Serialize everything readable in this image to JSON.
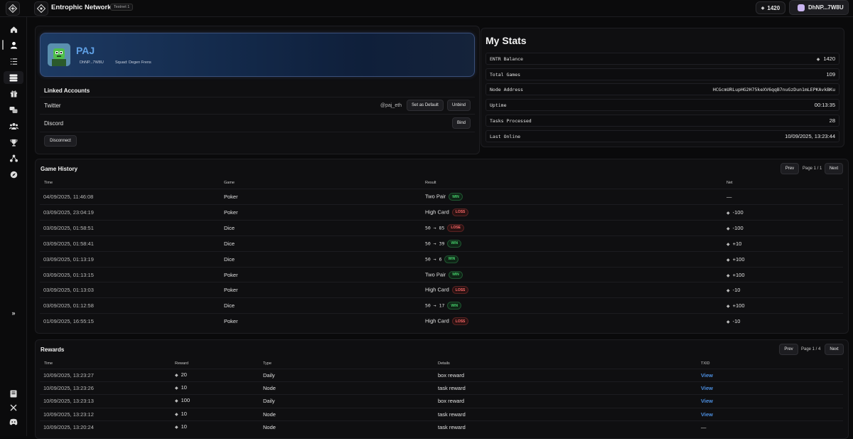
{
  "app": {
    "title": "Entrophic Network",
    "network_badge": "Testnet 1"
  },
  "topbar": {
    "balance": "1420",
    "wallet": "DhNP...7W8U"
  },
  "sidebar": {
    "items": [
      {
        "name": "home-icon"
      },
      {
        "name": "profile-icon"
      },
      {
        "name": "tasks-list-icon"
      },
      {
        "name": "nodes-icon"
      },
      {
        "name": "gift-icon"
      },
      {
        "name": "games-icon"
      },
      {
        "name": "squads-icon"
      },
      {
        "name": "trophy-icon"
      },
      {
        "name": "network-icon"
      },
      {
        "name": "explore-icon"
      }
    ],
    "active_index": 1,
    "selected_index": 3,
    "bottom_items": [
      {
        "name": "docs-icon"
      },
      {
        "name": "x-social-icon"
      },
      {
        "name": "discord-icon"
      }
    ]
  },
  "profile": {
    "name": "PAJ",
    "wallet_short": "DhNP...7W8U",
    "squad": "Squad: Degen Frens"
  },
  "linked_accounts": {
    "title": "Linked Accounts",
    "twitter": {
      "label": "Twitter",
      "handle": "@paj_eth",
      "set_default": "Set as Default",
      "unbind": "Unbind"
    },
    "discord": {
      "label": "Discord",
      "bind": "Bind"
    },
    "disconnect": "Disconnect"
  },
  "stats": {
    "title": "My Stats",
    "rows": [
      {
        "label": "ENTR Balance",
        "value": "1420",
        "diamond": true
      },
      {
        "label": "Total Games",
        "value": "109"
      },
      {
        "label": "Node Address",
        "value": "HCGcmURLupHG2H75keXV6qqB7nuGzDun1mLEPKAvkBKu"
      },
      {
        "label": "Uptime",
        "value": "00:13:35"
      },
      {
        "label": "Tasks Processed",
        "value": "28"
      },
      {
        "label": "Last Online",
        "value": "10/09/2025, 13:23:44"
      }
    ]
  },
  "game_history": {
    "title": "Game History",
    "prev": "Prev",
    "next": "Next",
    "page": "Page 1 / 1",
    "columns": [
      "Time",
      "Game",
      "Result",
      "Net"
    ],
    "rows": [
      {
        "time": "04/09/2025, 11:46:08",
        "game": "Poker",
        "result": "Two Pair",
        "badge": "WIN",
        "net": "—",
        "net_diamond": false
      },
      {
        "time": "03/09/2025, 23:04:19",
        "game": "Poker",
        "result": "High Card",
        "badge": "LOSS",
        "net": "-100",
        "net_diamond": true
      },
      {
        "time": "03/09/2025, 01:58:51",
        "game": "Dice",
        "result": "50 → 85",
        "badge": "LOSE",
        "net": "-100",
        "net_diamond": true,
        "mono": true
      },
      {
        "time": "03/09/2025, 01:58:41",
        "game": "Dice",
        "result": "50 → 39",
        "badge": "WIN",
        "net": "+10",
        "net_diamond": true,
        "mono": true
      },
      {
        "time": "03/09/2025, 01:13:19",
        "game": "Dice",
        "result": "50 → 6",
        "badge": "WIN",
        "net": "+100",
        "net_diamond": true,
        "mono": true
      },
      {
        "time": "03/09/2025, 01:13:15",
        "game": "Poker",
        "result": "Two Pair",
        "badge": "WIN",
        "net": "+100",
        "net_diamond": true
      },
      {
        "time": "03/09/2025, 01:13:03",
        "game": "Poker",
        "result": "High Card",
        "badge": "LOSS",
        "net": "-10",
        "net_diamond": true
      },
      {
        "time": "03/09/2025, 01:12:58",
        "game": "Dice",
        "result": "50 → 17",
        "badge": "WIN",
        "net": "+100",
        "net_diamond": true,
        "mono": true
      },
      {
        "time": "01/09/2025, 16:55:15",
        "game": "Poker",
        "result": "High Card",
        "badge": "LOSS",
        "net": "-10",
        "net_diamond": true
      }
    ]
  },
  "rewards": {
    "title": "Rewards",
    "prev": "Prev",
    "next": "Next",
    "page": "Page 1 / 4",
    "columns": [
      "Time",
      "Reward",
      "Type",
      "Details",
      "TXID"
    ],
    "rows": [
      {
        "time": "10/09/2025, 13:23:27",
        "reward": "20",
        "type": "Daily",
        "details": "box reward",
        "txid": "View"
      },
      {
        "time": "10/09/2025, 13:23:26",
        "reward": "10",
        "type": "Node",
        "details": "task reward",
        "txid": "View"
      },
      {
        "time": "10/09/2025, 13:23:13",
        "reward": "100",
        "type": "Daily",
        "details": "box reward",
        "txid": "View"
      },
      {
        "time": "10/09/2025, 13:23:12",
        "reward": "10",
        "type": "Node",
        "details": "task reward",
        "txid": "View"
      },
      {
        "time": "10/09/2025, 13:20:24",
        "reward": "10",
        "type": "Node",
        "details": "task reward",
        "txid": "—"
      }
    ]
  },
  "colors": {
    "accent_blue": "#5fa0e6",
    "win_green": "#46d06b",
    "loss_red": "#ff6a6a",
    "link_blue": "#4c8fe0"
  }
}
